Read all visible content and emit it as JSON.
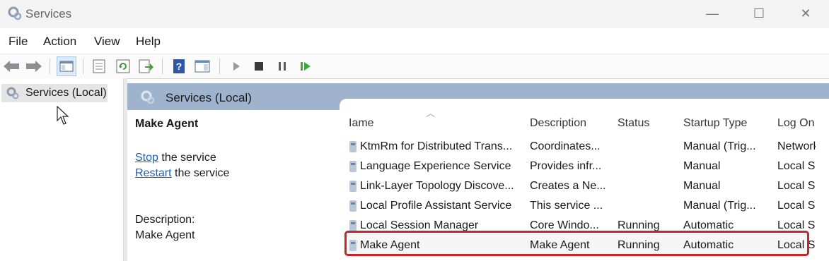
{
  "window": {
    "title": "Services",
    "controls": {
      "minimize": "—",
      "maximize": "☐",
      "close": "✕"
    }
  },
  "menu": [
    "File",
    "Action",
    "View",
    "Help"
  ],
  "toolbar": {
    "icons": [
      "back-arrow-icon",
      "forward-arrow-icon",
      "show-console-tree-icon",
      "properties-icon",
      "refresh-icon",
      "export-list-icon",
      "help-icon",
      "show-action-pane-icon",
      "start-service-icon",
      "stop-service-icon",
      "pause-service-icon",
      "resume-service-icon"
    ]
  },
  "tree": {
    "selected": "Services (Local)"
  },
  "pane": {
    "header": "Services (Local)",
    "selected_name": "Make Agent",
    "stop_link": "Stop",
    "stop_suffix": " the service",
    "restart_link": "Restart",
    "restart_suffix": " the service",
    "description_label": "Description:",
    "description_value": "Make Agent"
  },
  "columns": [
    "Iame",
    "Description",
    "Status",
    "Startup Type",
    "Log On"
  ],
  "rows": [
    {
      "name": "KtmRm for Distributed Trans...",
      "description": "Coordinates...",
      "status": "",
      "startup": "Manual (Trig...",
      "logon": "Network"
    },
    {
      "name": "Language Experience Service",
      "description": "Provides infr...",
      "status": "",
      "startup": "Manual",
      "logon": "Local S"
    },
    {
      "name": "Link-Layer Topology Discove...",
      "description": "Creates a Ne...",
      "status": "",
      "startup": "Manual",
      "logon": "Local S"
    },
    {
      "name": "Local Profile Assistant Service",
      "description": "This service ...",
      "status": "",
      "startup": "Manual (Trig...",
      "logon": "Local S"
    },
    {
      "name": "Local Session Manager",
      "description": "Core Windo...",
      "status": "Running",
      "startup": "Automatic",
      "logon": "Local S"
    },
    {
      "name": "Make Agent",
      "description": "Make Agent",
      "status": "Running",
      "startup": "Automatic",
      "logon": "Local S"
    }
  ],
  "colors": {
    "header_bar": "#9fb3cd",
    "highlight": "#c0282d",
    "link": "#1a5fb4"
  }
}
